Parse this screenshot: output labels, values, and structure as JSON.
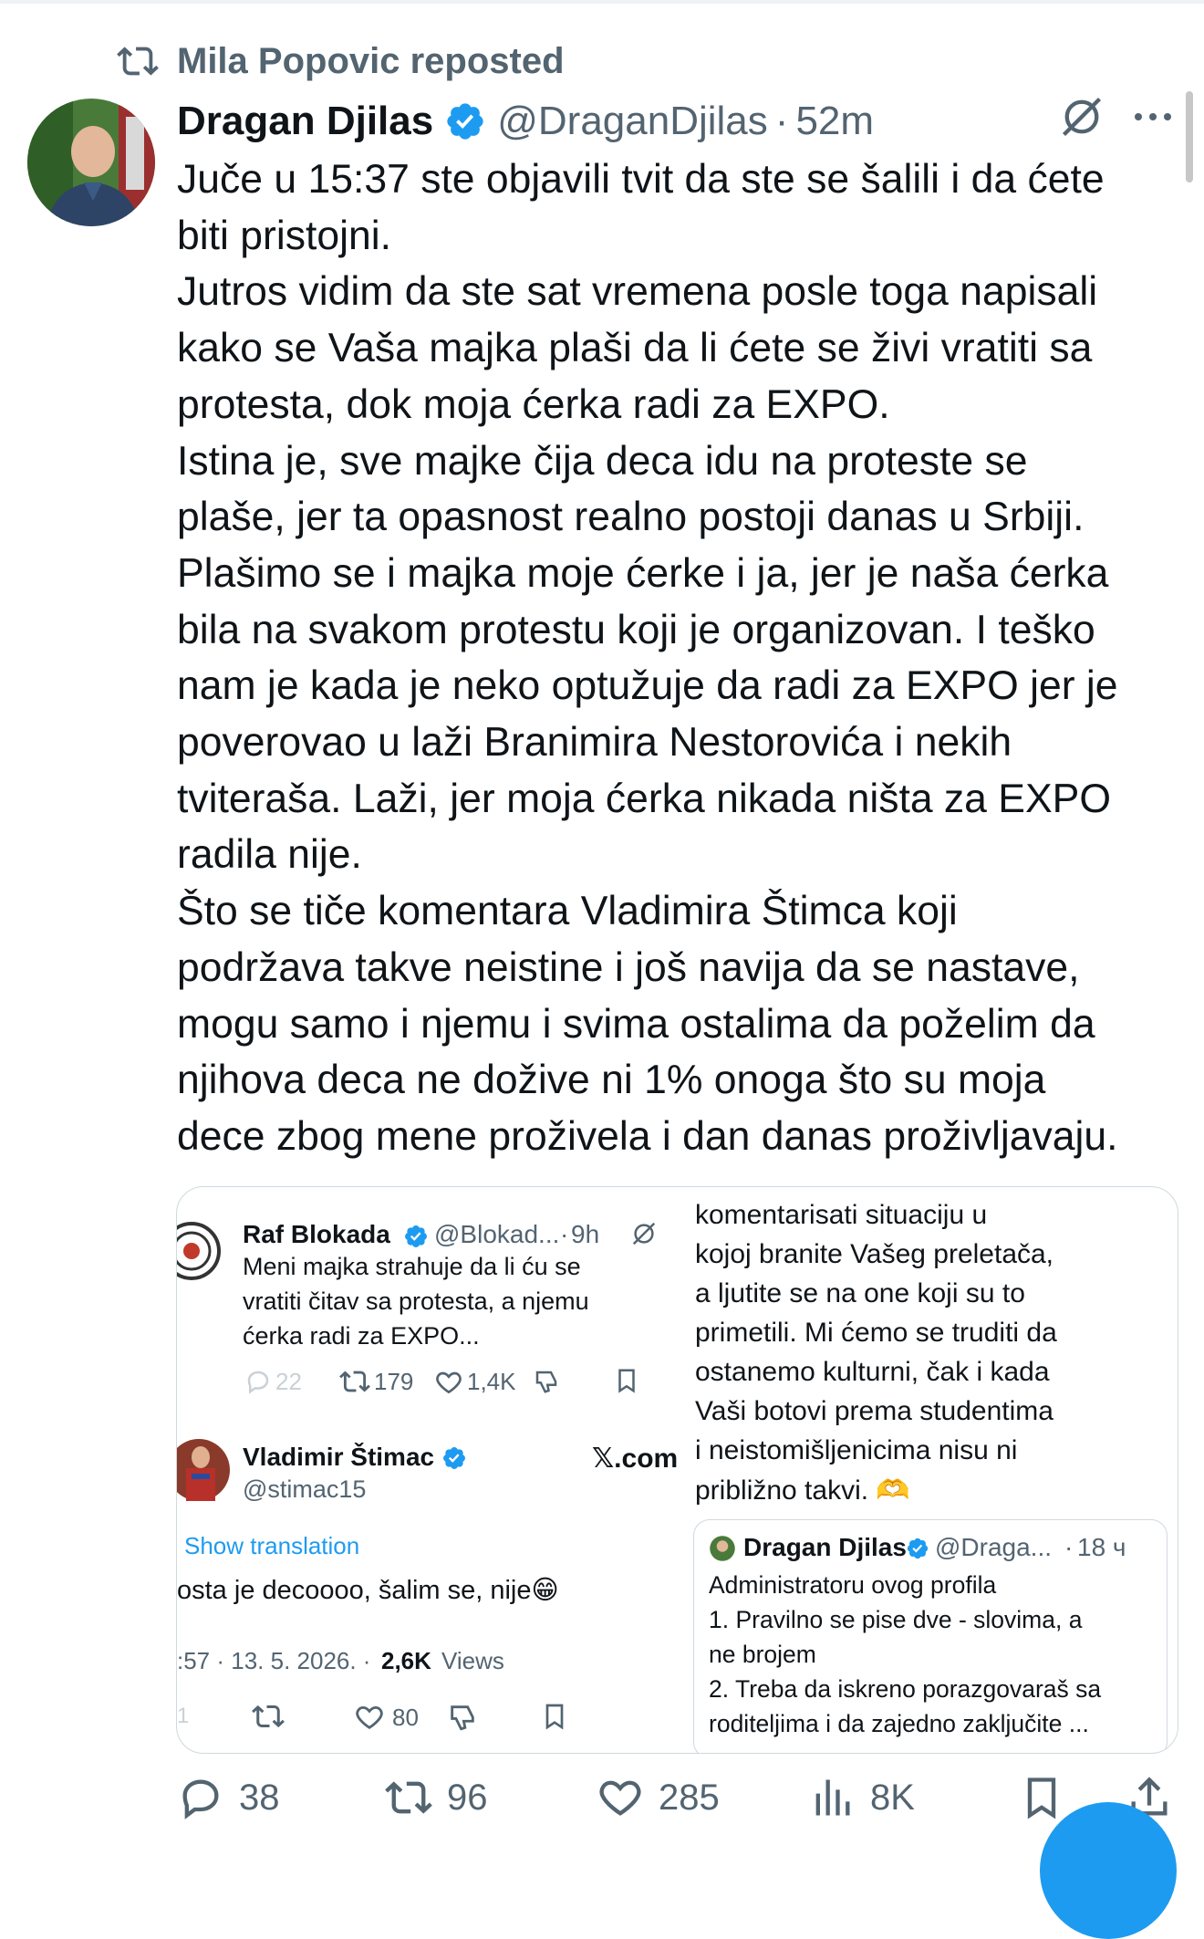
{
  "repost": {
    "text": "Mila Popovic reposted",
    "icon": "repost-icon"
  },
  "tweet": {
    "author_name": "Dragan Djilas",
    "handle": "@DraganDjilas",
    "separator": "·",
    "time": "52m",
    "verified": true,
    "body_lines": [
      "Juče u 15:37 ste objavili tvit da ste se šalili i da ćete",
      "biti pristojni.",
      "Jutros vidim da ste sat vremena posle toga napisali",
      "kako se Vaša majka plaši da li ćete se živi vratiti sa",
      "protesta, dok moja ćerka radi za EXPO.",
      "Istina je, sve majke čija deca idu na proteste se",
      "plaše, jer ta opasnost realno postoji danas u Srbiji.",
      "Plašimo se i majka moje ćerke i ja, jer je naša ćerka",
      "bila na svakom protestu koji je organizovan. I teško",
      "nam je kada je neko optužuje da radi za EXPO jer je",
      "poverovao u laži Branimira Nestorovića i nekih",
      "tviteraša. Laži, jer moja ćerka nikada ništa za EXPO",
      "radila nije.",
      "Što se tiče komentara Vladimira Štimca koji",
      "podržava takve neistine i još navija da se nastave,",
      "mogu samo i njemu i svima ostalima da poželim da",
      "njihova deca ne dožive ni 1% onoga što su moja",
      "dece zbog mene proživela i dan danas proživljavaju."
    ],
    "stats": {
      "replies": "38",
      "reposts": "96",
      "likes": "285",
      "views": "8K"
    }
  },
  "embedded_left": {
    "tweet1": {
      "name": "Raf Blokada",
      "handle": "@Blokad...",
      "separator": "·",
      "time": "9h",
      "lines": [
        "Meni majka strahuje da li ću se",
        "vratiti čitav sa protesta, a njemu",
        "ćerka radi za EXPO..."
      ],
      "replies": "22",
      "reposts": "179",
      "likes": "1,4K"
    },
    "tweet2": {
      "name": "Vladimir Štimac",
      "handle": "@stimac15",
      "brand": "𝕏.com",
      "show_translation": "Show translation",
      "text": "osta je decoooo, šalim se, nije😁",
      "time_date": ":57 · 13. 5. 2026. ·",
      "views_count": "2,6K",
      "views_label": "Views",
      "likes": "80",
      "replies": "1"
    }
  },
  "embedded_right": {
    "lines": [
      "komentarisati situaciju u",
      "kojoj branite Vašeg preletača,",
      "a ljutite se na one koji su to",
      "primetili. Mi ćemo se truditi da",
      "ostanemo kulturni, čak i kada",
      "Vaši botovi prema studentima",
      "i neistomišljenicima nisu ni",
      "približno takvi. 🫶"
    ],
    "quoted": {
      "name": "Dragan Djilas",
      "handle": "@Draga...",
      "separator": "·",
      "time": "18 ч",
      "lines": [
        "Administratoru ovog profila",
        "1.  Pravilno se pise dve - slovima, a",
        "ne brojem",
        "2. Treba da iskreno porazgovaraš sa",
        "roditeljima i da zajedno zaključite ..."
      ]
    }
  },
  "colors": {
    "accent": "#1d9bf0",
    "text": "#0f1419",
    "secondary": "#536471",
    "border": "#cfd9de"
  }
}
